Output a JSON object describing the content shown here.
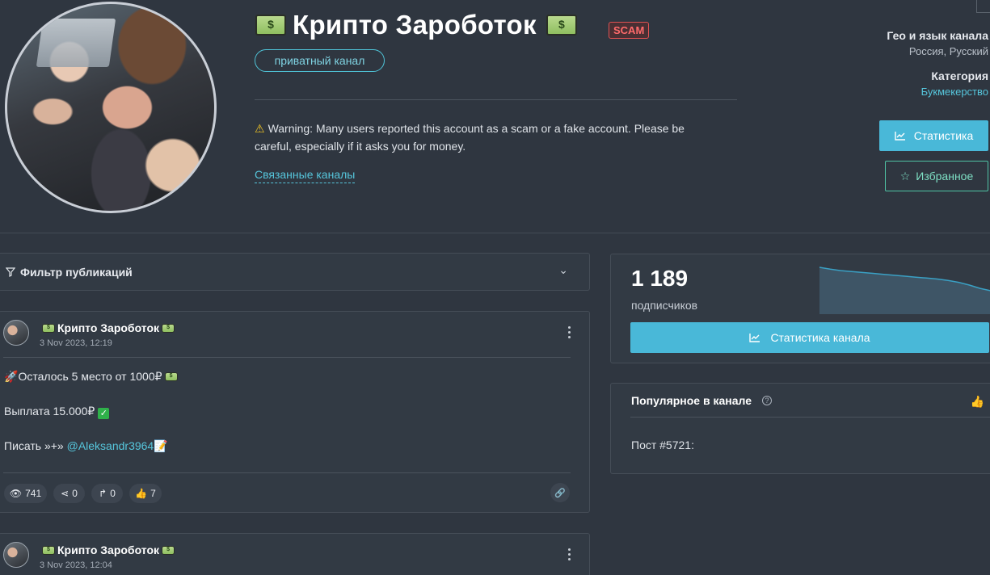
{
  "channel": {
    "title": "Крипто Зароботок",
    "scam_badge": "SCAM",
    "privacy": "приватный канал",
    "warning": "Warning: Many users reported this account as a scam or a fake account. Please be careful, especially if it asks you for money.",
    "related_link": "Связанные каналы"
  },
  "sidebar_info": {
    "geo_label": "Гео и язык канала",
    "geo_value": "Россия, Русский",
    "category_label": "Категория",
    "category_value": "Букмекерство"
  },
  "actions": {
    "stats_label": "Статистика",
    "favorite_label": "Избранное"
  },
  "filter": {
    "label": "Фильтр публикаций"
  },
  "posts": [
    {
      "channel_name": "Крипто Зароботок",
      "date": "3 Nov 2023, 12:19",
      "line1": "Осталось 5 место от 1000₽",
      "line2": "Выплата 15.000₽",
      "line3_prefix": "Писать »+» ",
      "mention": "@Aleksandr3964",
      "views": "741",
      "shares": "0",
      "forwards": "0",
      "likes": "7"
    },
    {
      "channel_name": "Крипто Зароботок",
      "date": "3 Nov 2023, 12:04"
    }
  ],
  "subscribers": {
    "count": "1 189",
    "label": "подписчиков",
    "button_label": "Статистика канала",
    "trend": [
      100,
      96,
      93,
      91,
      89,
      87,
      85,
      83,
      81,
      79,
      77,
      75,
      72,
      68,
      62,
      55,
      50
    ],
    "chart_color": "#3aa0c4",
    "fill_color": "#3e5566"
  },
  "popular": {
    "title": "Популярное в канале",
    "post_label": "Пост #5721:"
  },
  "colors": {
    "accent": "#49b8d8",
    "scam": "#ff6b6b",
    "favorite": "#4fc3a4",
    "background": "#2f3640"
  }
}
